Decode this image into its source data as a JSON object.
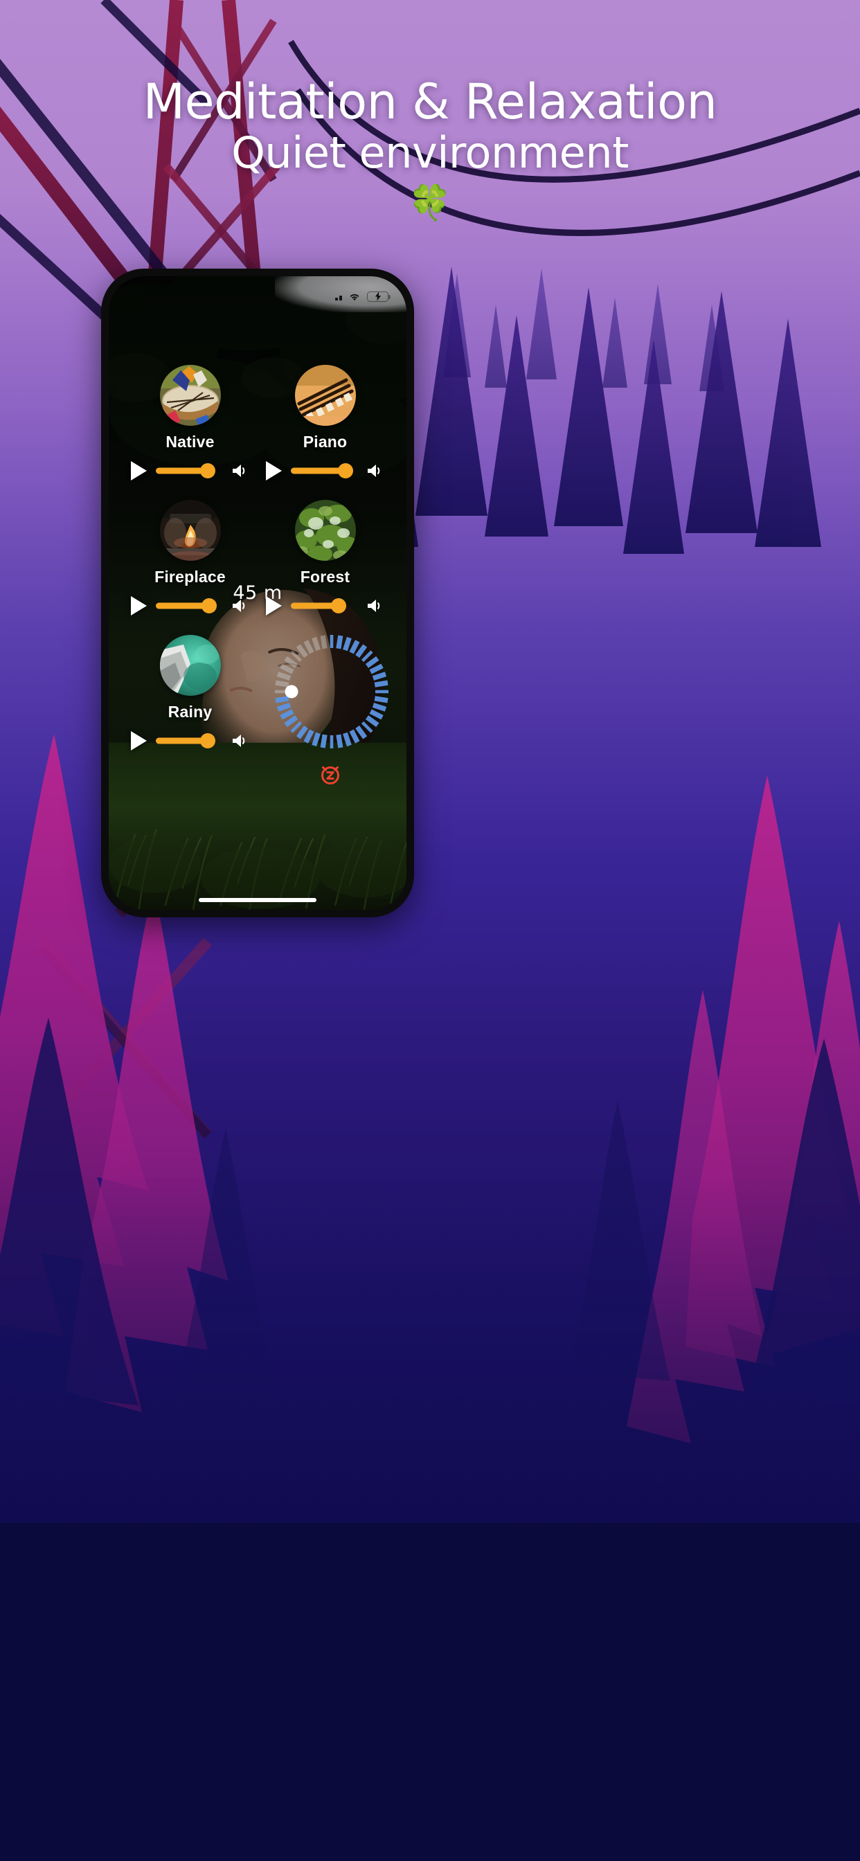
{
  "page": {
    "background_color": "#0a0a3c",
    "accent_orange": "#f5a623",
    "accent_blue": "#5b93e0",
    "alarm_red": "#ef4130"
  },
  "header": {
    "line1": "Meditation & Relaxation",
    "line2": "Quiet environment",
    "decoration": "🍀",
    "decoration_name": "four-leaf-clover"
  },
  "phone": {
    "status_bar": {
      "signal_icon": "cellular-signal-icon",
      "wifi_icon": "wifi-icon",
      "battery_icon": "battery-charging-icon",
      "battery_charging": true
    },
    "home_indicator": "home-indicator"
  },
  "app": {
    "sounds": [
      {
        "id": "native",
        "label": "Native",
        "thumb": "native-drum-thumb",
        "playing": false,
        "volume_pct": 78,
        "play_icon": "play-icon",
        "volume_icon": "speaker-icon"
      },
      {
        "id": "piano",
        "label": "Piano",
        "thumb": "piano-keys-thumb",
        "playing": false,
        "volume_pct": 82,
        "play_icon": "play-icon",
        "volume_icon": "speaker-icon"
      },
      {
        "id": "fireplace",
        "label": "Fireplace",
        "thumb": "fireplace-thumb",
        "playing": false,
        "volume_pct": 80,
        "play_icon": "play-icon",
        "volume_icon": "speaker-icon"
      },
      {
        "id": "forest",
        "label": "Forest",
        "thumb": "forest-trees-thumb",
        "playing": false,
        "volume_pct": 72,
        "play_icon": "play-icon",
        "volume_icon": "speaker-icon"
      },
      {
        "id": "rainy",
        "label": "Rainy",
        "thumb": "rain-cloud-thumb",
        "playing": false,
        "volume_pct": 78,
        "play_icon": "play-icon",
        "volume_icon": "speaker-icon"
      }
    ],
    "timer": {
      "value_label": "45 m",
      "minutes": 45,
      "max_minutes": 60,
      "fill_pct": 75,
      "tick_count": 40,
      "dial_name": "sleep-timer-dial",
      "handle_name": "sleep-timer-handle"
    },
    "alarm": {
      "icon": "alarm-snooze-icon",
      "color": "#ef4130"
    }
  }
}
